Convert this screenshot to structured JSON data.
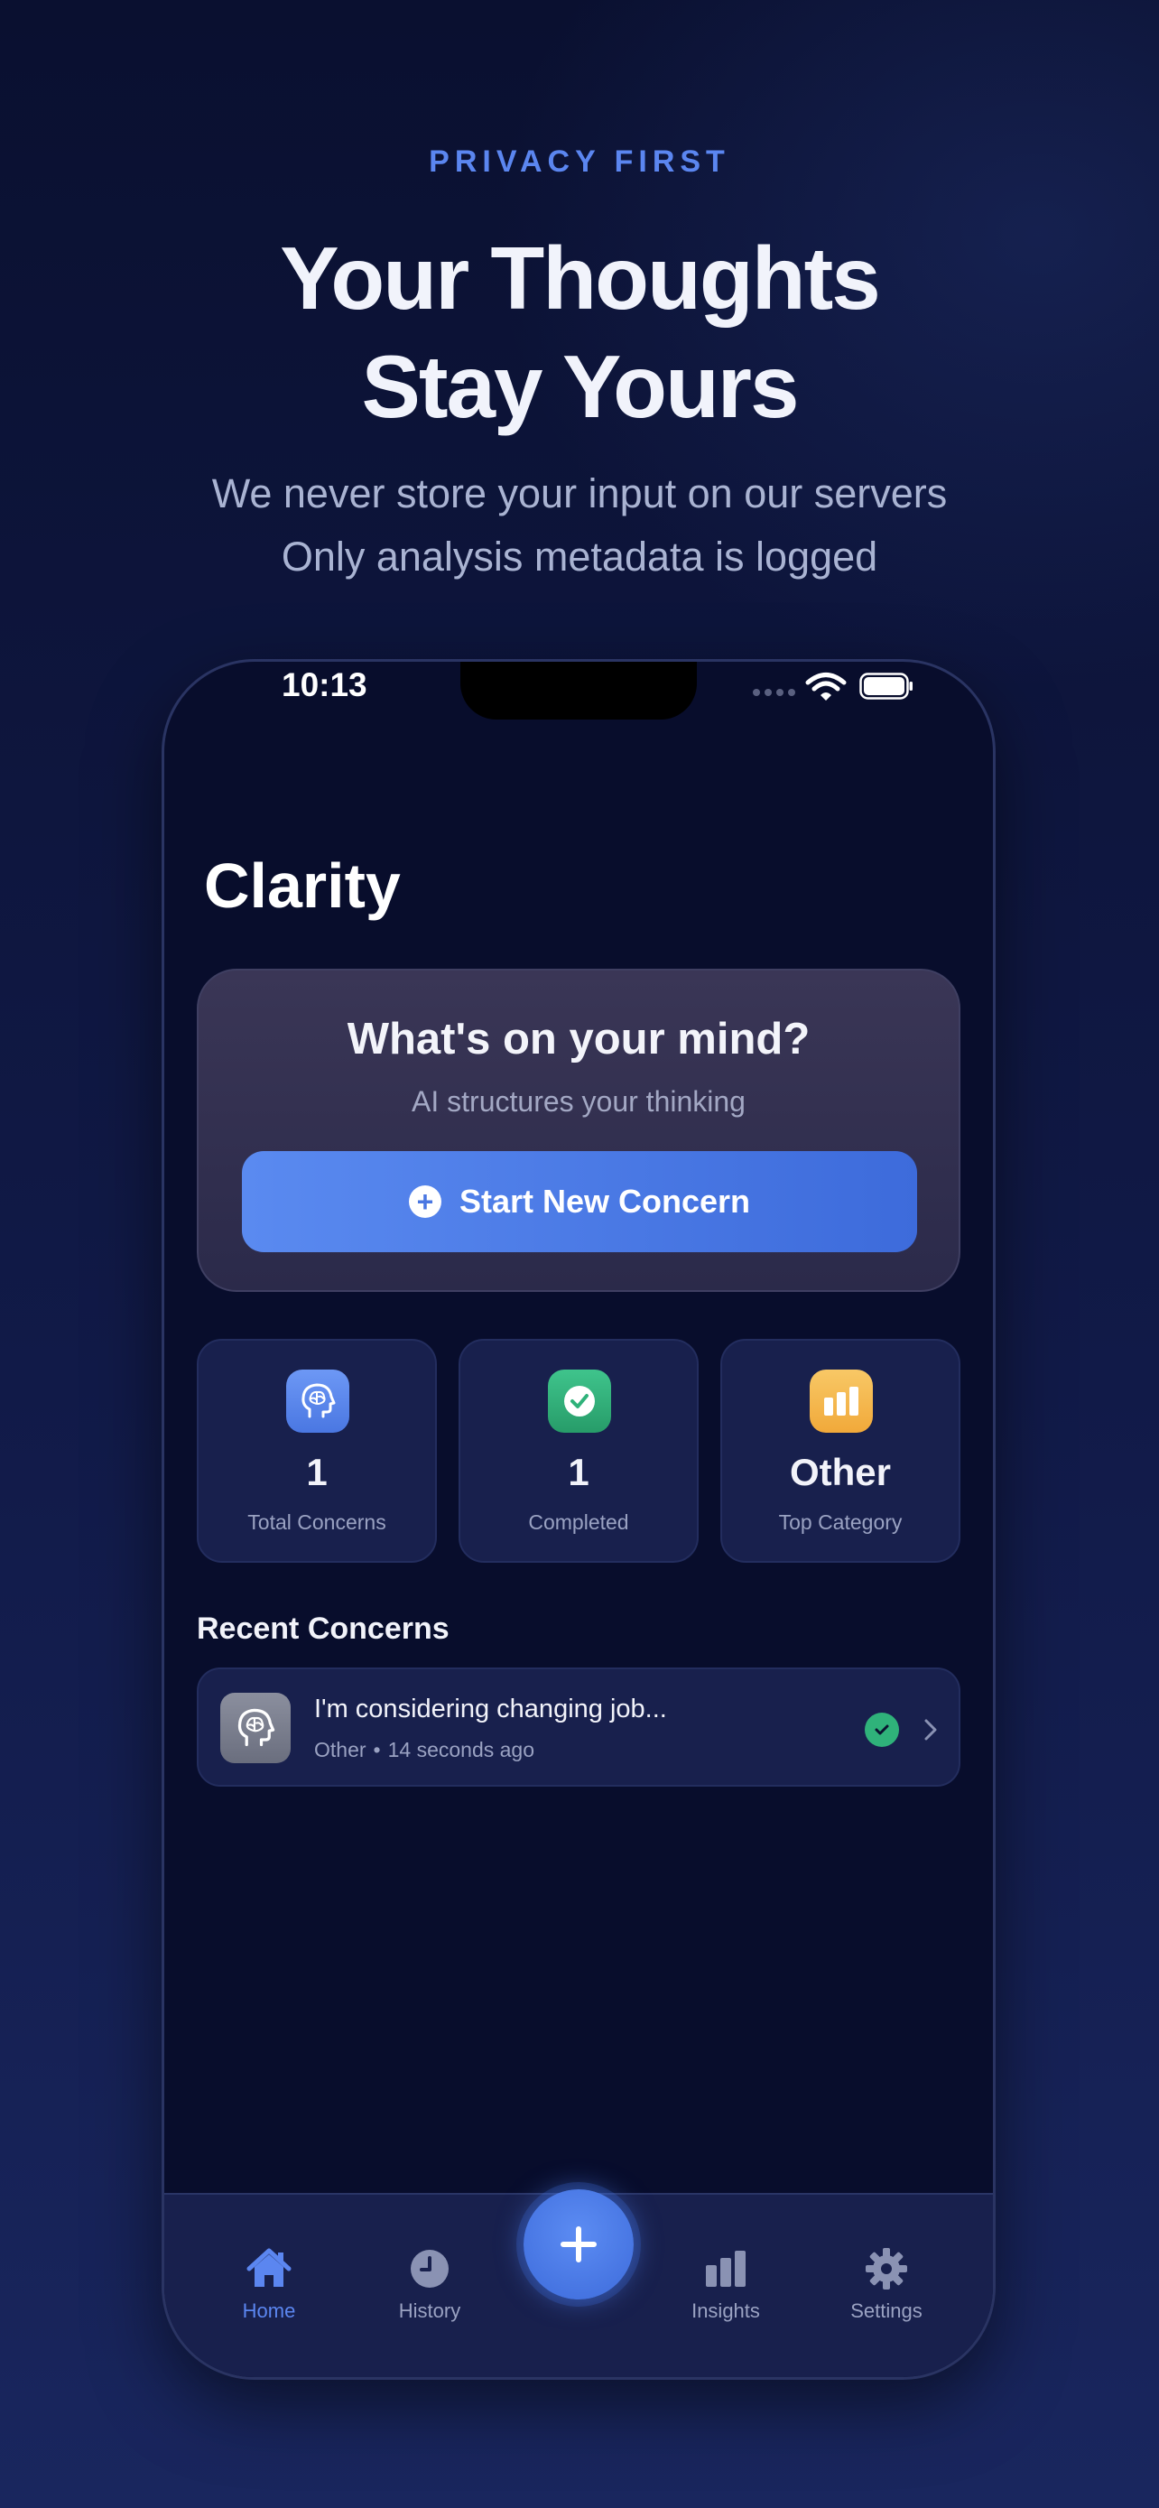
{
  "header": {
    "eyebrow": "PRIVACY FIRST",
    "headline_line1": "Your Thoughts",
    "headline_line2": "Stay Yours",
    "subline_line1": "We never store your input on our servers",
    "subline_line2": "Only analysis metadata is logged"
  },
  "status_bar": {
    "time": "10:13"
  },
  "app": {
    "title": "Clarity",
    "hero": {
      "title": "What's on your mind?",
      "subtitle": "AI structures your thinking",
      "button_label": "Start New Concern"
    },
    "stats": [
      {
        "value": "1",
        "label": "Total Concerns",
        "icon": "brain-icon",
        "color": "#5b86f0"
      },
      {
        "value": "1",
        "label": "Completed",
        "icon": "check-icon",
        "color": "#2fb27a"
      },
      {
        "value": "Other",
        "label": "Top Category",
        "icon": "bar-chart-icon",
        "color": "#f6b94f"
      }
    ],
    "recent": {
      "title": "Recent Concerns",
      "items": [
        {
          "title": "I'm considering changing job...",
          "category": "Other",
          "separator": "•",
          "time": "14 seconds ago",
          "status": "completed"
        }
      ]
    },
    "tabs": [
      {
        "label": "Home",
        "icon": "home-icon",
        "active": true
      },
      {
        "label": "History",
        "icon": "clock-icon",
        "active": false
      },
      {
        "label": "Insights",
        "icon": "bar-chart-icon",
        "active": false
      },
      {
        "label": "Settings",
        "icon": "gear-icon",
        "active": false
      }
    ]
  },
  "colors": {
    "accent": "#5b86f0",
    "success": "#2fb27a",
    "warning": "#f6b94f",
    "background": "#080d2c",
    "card": "#18204d"
  }
}
